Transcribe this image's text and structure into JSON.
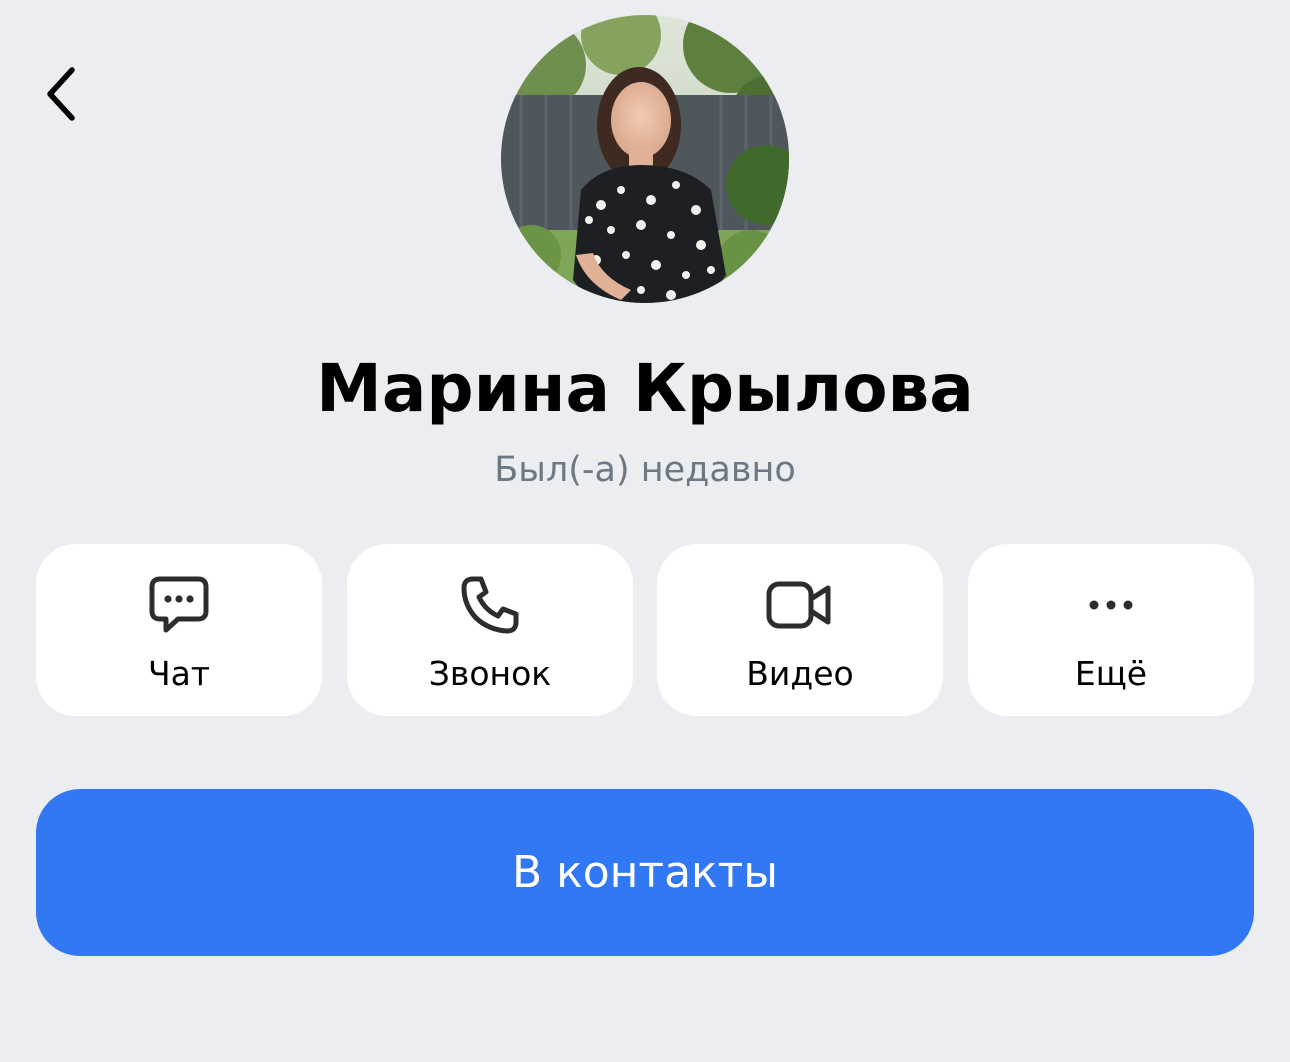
{
  "header": {
    "back_icon": "chevron-left-icon"
  },
  "profile": {
    "name": "Марина Крылова",
    "status": "Был(-а) недавно",
    "avatar_description": "photo-avatar"
  },
  "actions": [
    {
      "label": "Чат",
      "icon": "chat-bubble-icon"
    },
    {
      "label": "Звонок",
      "icon": "phone-icon"
    },
    {
      "label": "Видео",
      "icon": "video-camera-icon"
    },
    {
      "label": "Ещё",
      "icon": "more-dots-icon"
    }
  ],
  "primary_button": {
    "label": "В контакты"
  },
  "colors": {
    "background": "#ebedf0",
    "card": "#ffffff",
    "accent": "#3278f4",
    "status_text": "#6d7885"
  }
}
